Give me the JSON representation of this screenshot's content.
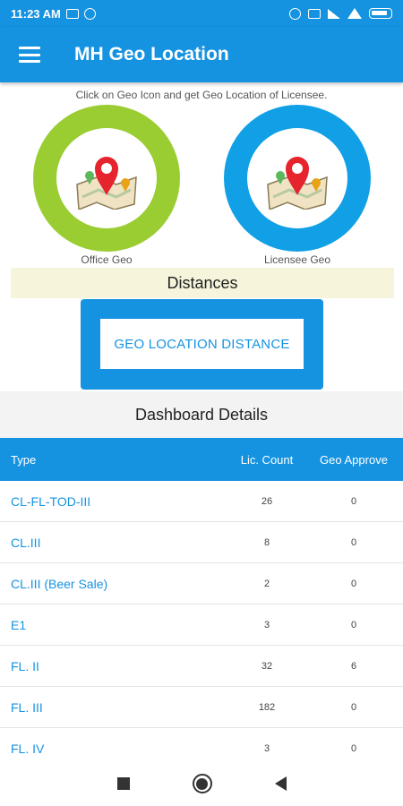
{
  "status_bar": {
    "time": "11:23 AM"
  },
  "app_bar": {
    "title": "MH Geo Location"
  },
  "instruction": "Click on Geo Icon and get Geo Location of Licensee.",
  "geo": {
    "office_label": "Office Geo",
    "licensee_label": "Licensee Geo",
    "office_ring_color": "#9acd32",
    "licensee_ring_color": "#11a0e6"
  },
  "distances": {
    "title": "Distances",
    "button_label": "GEO LOCATION DISTANCE"
  },
  "dashboard": {
    "title": "Dashboard Details",
    "headers": {
      "type": "Type",
      "count": "Lic. Count",
      "geo": "Geo Approve"
    },
    "rows": [
      {
        "type": "CL-FL-TOD-III",
        "count": "26",
        "geo": "0"
      },
      {
        "type": "CL.III",
        "count": "8",
        "geo": "0"
      },
      {
        "type": "CL.III (Beer Sale)",
        "count": "2",
        "geo": "0"
      },
      {
        "type": "E1",
        "count": "3",
        "geo": "0"
      },
      {
        "type": "FL. II",
        "count": "32",
        "geo": "6"
      },
      {
        "type": "FL. III",
        "count": "182",
        "geo": "0"
      },
      {
        "type": "FL. IV",
        "count": "3",
        "geo": "0"
      }
    ]
  },
  "colors": {
    "primary": "#1693e0",
    "highlight_bar": "#f6f5dc"
  }
}
